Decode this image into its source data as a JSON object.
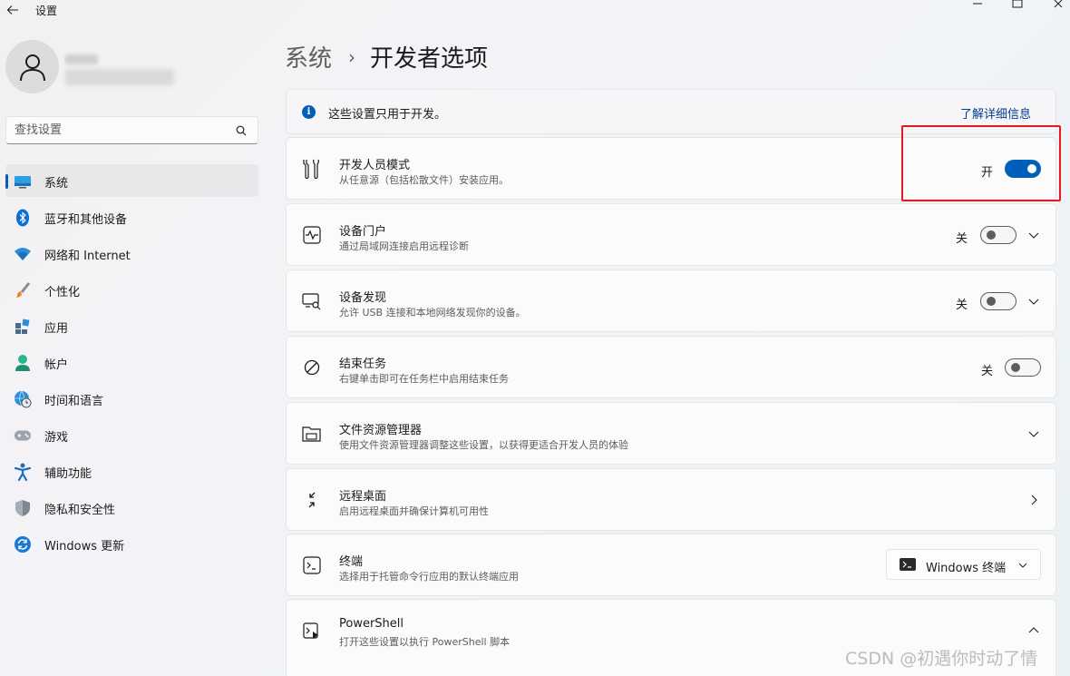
{
  "app": {
    "title": "设置"
  },
  "sidebar": {
    "search_placeholder": "查找设置",
    "items": [
      {
        "label": "系统",
        "icon": "system-icon",
        "active": true
      },
      {
        "label": "蓝牙和其他设备",
        "icon": "bluetooth-icon"
      },
      {
        "label": "网络和 Internet",
        "icon": "wifi-icon"
      },
      {
        "label": "个性化",
        "icon": "brush-icon"
      },
      {
        "label": "应用",
        "icon": "apps-icon"
      },
      {
        "label": "帐户",
        "icon": "account-icon"
      },
      {
        "label": "时间和语言",
        "icon": "globe-clock-icon"
      },
      {
        "label": "游戏",
        "icon": "gamepad-icon"
      },
      {
        "label": "辅助功能",
        "icon": "accessibility-icon"
      },
      {
        "label": "隐私和安全性",
        "icon": "shield-icon"
      },
      {
        "label": "Windows 更新",
        "icon": "update-icon"
      }
    ]
  },
  "header": {
    "root": "系统",
    "separator": "›",
    "current": "开发者选项"
  },
  "info": {
    "text": "这些设置只用于开发。",
    "link": "了解详细信息"
  },
  "rows": [
    {
      "title": "开发人员模式",
      "subtitle": "从任意源（包括松散文件）安装应用。",
      "icon": "developer-tools-icon",
      "toggle_state": "开",
      "toggle_on": true
    },
    {
      "title": "设备门户",
      "subtitle": "通过局域网连接启用远程诊断",
      "icon": "device-portal-icon",
      "toggle_state": "关",
      "toggle_on": false
    },
    {
      "title": "设备发现",
      "subtitle": "允许 USB 连接和本地网络发现你的设备。",
      "icon": "device-discovery-icon",
      "toggle_state": "关",
      "toggle_on": false
    },
    {
      "title": "结束任务",
      "subtitle": "右键单击即可在任务栏中启用结束任务",
      "icon": "end-task-icon",
      "toggle_state": "关",
      "toggle_on": false
    },
    {
      "title": "文件资源管理器",
      "subtitle": "使用文件资源管理器调整这些设置，以获得更适合开发人员的体验",
      "icon": "file-explorer-icon"
    },
    {
      "title": "远程桌面",
      "subtitle": "启用远程桌面并确保计算机可用性",
      "icon": "remote-desktop-icon"
    },
    {
      "title": "终端",
      "subtitle": "选择用于托管命令行应用的默认终端应用",
      "icon": "terminal-icon",
      "dropdown_value": "Windows 终端"
    },
    {
      "title": "PowerShell",
      "subtitle": "打开这些设置以执行 PowerShell 脚本",
      "icon": "powershell-icon"
    }
  ],
  "watermark": "CSDN @初遇你时动了情",
  "colors": {
    "accent": "#005fb8",
    "highlight_box": "#e5191f",
    "link": "#003e92"
  }
}
